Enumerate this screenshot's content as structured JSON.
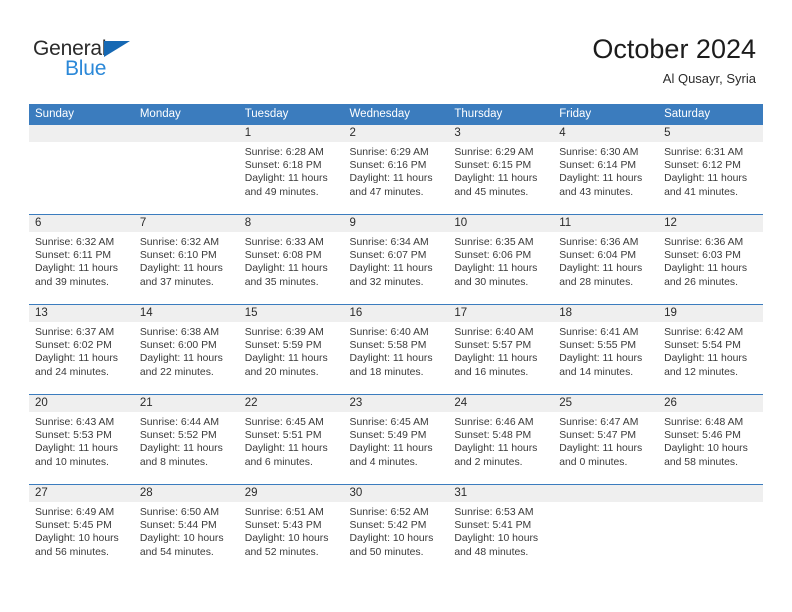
{
  "brand": {
    "name_part1": "General",
    "name_part2": "Blue",
    "triangle_color": "#1668b3",
    "blue_color": "#2b88d8"
  },
  "header": {
    "title": "October 2024",
    "subtitle": "Al Qusayr, Syria"
  },
  "theme": {
    "header_blue": "#3b7cbe",
    "daynum_band": "#efefef",
    "text": "#3a3a3a"
  },
  "weekdays": [
    "Sunday",
    "Monday",
    "Tuesday",
    "Wednesday",
    "Thursday",
    "Friday",
    "Saturday"
  ],
  "weeks": [
    [
      {
        "day": "",
        "sunrise": "",
        "sunset": "",
        "daylight_line1": "",
        "daylight_line2": ""
      },
      {
        "day": "",
        "sunrise": "",
        "sunset": "",
        "daylight_line1": "",
        "daylight_line2": ""
      },
      {
        "day": "1",
        "sunrise": "Sunrise: 6:28 AM",
        "sunset": "Sunset: 6:18 PM",
        "daylight_line1": "Daylight: 11 hours",
        "daylight_line2": "and 49 minutes."
      },
      {
        "day": "2",
        "sunrise": "Sunrise: 6:29 AM",
        "sunset": "Sunset: 6:16 PM",
        "daylight_line1": "Daylight: 11 hours",
        "daylight_line2": "and 47 minutes."
      },
      {
        "day": "3",
        "sunrise": "Sunrise: 6:29 AM",
        "sunset": "Sunset: 6:15 PM",
        "daylight_line1": "Daylight: 11 hours",
        "daylight_line2": "and 45 minutes."
      },
      {
        "day": "4",
        "sunrise": "Sunrise: 6:30 AM",
        "sunset": "Sunset: 6:14 PM",
        "daylight_line1": "Daylight: 11 hours",
        "daylight_line2": "and 43 minutes."
      },
      {
        "day": "5",
        "sunrise": "Sunrise: 6:31 AM",
        "sunset": "Sunset: 6:12 PM",
        "daylight_line1": "Daylight: 11 hours",
        "daylight_line2": "and 41 minutes."
      }
    ],
    [
      {
        "day": "6",
        "sunrise": "Sunrise: 6:32 AM",
        "sunset": "Sunset: 6:11 PM",
        "daylight_line1": "Daylight: 11 hours",
        "daylight_line2": "and 39 minutes."
      },
      {
        "day": "7",
        "sunrise": "Sunrise: 6:32 AM",
        "sunset": "Sunset: 6:10 PM",
        "daylight_line1": "Daylight: 11 hours",
        "daylight_line2": "and 37 minutes."
      },
      {
        "day": "8",
        "sunrise": "Sunrise: 6:33 AM",
        "sunset": "Sunset: 6:08 PM",
        "daylight_line1": "Daylight: 11 hours",
        "daylight_line2": "and 35 minutes."
      },
      {
        "day": "9",
        "sunrise": "Sunrise: 6:34 AM",
        "sunset": "Sunset: 6:07 PM",
        "daylight_line1": "Daylight: 11 hours",
        "daylight_line2": "and 32 minutes."
      },
      {
        "day": "10",
        "sunrise": "Sunrise: 6:35 AM",
        "sunset": "Sunset: 6:06 PM",
        "daylight_line1": "Daylight: 11 hours",
        "daylight_line2": "and 30 minutes."
      },
      {
        "day": "11",
        "sunrise": "Sunrise: 6:36 AM",
        "sunset": "Sunset: 6:04 PM",
        "daylight_line1": "Daylight: 11 hours",
        "daylight_line2": "and 28 minutes."
      },
      {
        "day": "12",
        "sunrise": "Sunrise: 6:36 AM",
        "sunset": "Sunset: 6:03 PM",
        "daylight_line1": "Daylight: 11 hours",
        "daylight_line2": "and 26 minutes."
      }
    ],
    [
      {
        "day": "13",
        "sunrise": "Sunrise: 6:37 AM",
        "sunset": "Sunset: 6:02 PM",
        "daylight_line1": "Daylight: 11 hours",
        "daylight_line2": "and 24 minutes."
      },
      {
        "day": "14",
        "sunrise": "Sunrise: 6:38 AM",
        "sunset": "Sunset: 6:00 PM",
        "daylight_line1": "Daylight: 11 hours",
        "daylight_line2": "and 22 minutes."
      },
      {
        "day": "15",
        "sunrise": "Sunrise: 6:39 AM",
        "sunset": "Sunset: 5:59 PM",
        "daylight_line1": "Daylight: 11 hours",
        "daylight_line2": "and 20 minutes."
      },
      {
        "day": "16",
        "sunrise": "Sunrise: 6:40 AM",
        "sunset": "Sunset: 5:58 PM",
        "daylight_line1": "Daylight: 11 hours",
        "daylight_line2": "and 18 minutes."
      },
      {
        "day": "17",
        "sunrise": "Sunrise: 6:40 AM",
        "sunset": "Sunset: 5:57 PM",
        "daylight_line1": "Daylight: 11 hours",
        "daylight_line2": "and 16 minutes."
      },
      {
        "day": "18",
        "sunrise": "Sunrise: 6:41 AM",
        "sunset": "Sunset: 5:55 PM",
        "daylight_line1": "Daylight: 11 hours",
        "daylight_line2": "and 14 minutes."
      },
      {
        "day": "19",
        "sunrise": "Sunrise: 6:42 AM",
        "sunset": "Sunset: 5:54 PM",
        "daylight_line1": "Daylight: 11 hours",
        "daylight_line2": "and 12 minutes."
      }
    ],
    [
      {
        "day": "20",
        "sunrise": "Sunrise: 6:43 AM",
        "sunset": "Sunset: 5:53 PM",
        "daylight_line1": "Daylight: 11 hours",
        "daylight_line2": "and 10 minutes."
      },
      {
        "day": "21",
        "sunrise": "Sunrise: 6:44 AM",
        "sunset": "Sunset: 5:52 PM",
        "daylight_line1": "Daylight: 11 hours",
        "daylight_line2": "and 8 minutes."
      },
      {
        "day": "22",
        "sunrise": "Sunrise: 6:45 AM",
        "sunset": "Sunset: 5:51 PM",
        "daylight_line1": "Daylight: 11 hours",
        "daylight_line2": "and 6 minutes."
      },
      {
        "day": "23",
        "sunrise": "Sunrise: 6:45 AM",
        "sunset": "Sunset: 5:49 PM",
        "daylight_line1": "Daylight: 11 hours",
        "daylight_line2": "and 4 minutes."
      },
      {
        "day": "24",
        "sunrise": "Sunrise: 6:46 AM",
        "sunset": "Sunset: 5:48 PM",
        "daylight_line1": "Daylight: 11 hours",
        "daylight_line2": "and 2 minutes."
      },
      {
        "day": "25",
        "sunrise": "Sunrise: 6:47 AM",
        "sunset": "Sunset: 5:47 PM",
        "daylight_line1": "Daylight: 11 hours",
        "daylight_line2": "and 0 minutes."
      },
      {
        "day": "26",
        "sunrise": "Sunrise: 6:48 AM",
        "sunset": "Sunset: 5:46 PM",
        "daylight_line1": "Daylight: 10 hours",
        "daylight_line2": "and 58 minutes."
      }
    ],
    [
      {
        "day": "27",
        "sunrise": "Sunrise: 6:49 AM",
        "sunset": "Sunset: 5:45 PM",
        "daylight_line1": "Daylight: 10 hours",
        "daylight_line2": "and 56 minutes."
      },
      {
        "day": "28",
        "sunrise": "Sunrise: 6:50 AM",
        "sunset": "Sunset: 5:44 PM",
        "daylight_line1": "Daylight: 10 hours",
        "daylight_line2": "and 54 minutes."
      },
      {
        "day": "29",
        "sunrise": "Sunrise: 6:51 AM",
        "sunset": "Sunset: 5:43 PM",
        "daylight_line1": "Daylight: 10 hours",
        "daylight_line2": "and 52 minutes."
      },
      {
        "day": "30",
        "sunrise": "Sunrise: 6:52 AM",
        "sunset": "Sunset: 5:42 PM",
        "daylight_line1": "Daylight: 10 hours",
        "daylight_line2": "and 50 minutes."
      },
      {
        "day": "31",
        "sunrise": "Sunrise: 6:53 AM",
        "sunset": "Sunset: 5:41 PM",
        "daylight_line1": "Daylight: 10 hours",
        "daylight_line2": "and 48 minutes."
      },
      {
        "day": "",
        "sunrise": "",
        "sunset": "",
        "daylight_line1": "",
        "daylight_line2": ""
      },
      {
        "day": "",
        "sunrise": "",
        "sunset": "",
        "daylight_line1": "",
        "daylight_line2": ""
      }
    ]
  ]
}
